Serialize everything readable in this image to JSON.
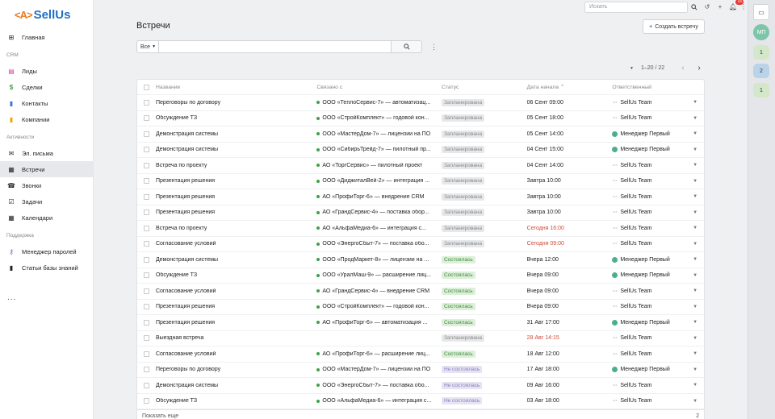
{
  "app": {
    "logo_brackets": "<A>",
    "logo_name": "SellUs"
  },
  "sidebar": {
    "home": "Главная",
    "section_crm": "CRM",
    "leads": "Лиды",
    "deals": "Сделки",
    "contacts": "Контакты",
    "companies": "Компании",
    "section_activities": "Активности",
    "emails": "Эл. письма",
    "meetings": "Встречи",
    "calls": "Звонки",
    "tasks": "Задачи",
    "calendars": "Календари",
    "section_support": "Поддержка",
    "password_manager": "Менеджер паролей",
    "kb_articles": "Статьи базы знаний",
    "more": "..."
  },
  "topbar": {
    "search_placeholder": "Искать",
    "notif_count": "15"
  },
  "page": {
    "title": "Встречи",
    "create_button": "Создать встречу",
    "filter_select": "Все",
    "pager": "1–20 / 22"
  },
  "table": {
    "headers": {
      "name": "Название",
      "related": "Связано с",
      "status": "Статус",
      "date": "Дата начала",
      "owner": "Ответственный"
    },
    "rows": [
      {
        "name": "Переговоры по договору",
        "related": "ООО «ТеплоСервис-7» — автоматизац...",
        "status": "Запланирована",
        "date": "06 Сент 09:00",
        "owner": "SellUs Team"
      },
      {
        "name": "Обсуждение ТЗ",
        "related": "ООО «СтройКомплект» — годовой кон...",
        "status": "Запланирована",
        "date": "05 Сент 18:00",
        "owner": "SellUs Team"
      },
      {
        "name": "Демонстрация системы",
        "related": "ООО «МастерДом-7» — лицензии на ПО",
        "status": "Запланирована",
        "date": "05 Сент 14:00",
        "owner": "Менеджер Первый"
      },
      {
        "name": "Демонстрация системы",
        "related": "ООО «СибирьТрейд-7» — пилотный пр...",
        "status": "Запланирована",
        "date": "04 Сент 15:00",
        "owner": "Менеджер Первый"
      },
      {
        "name": "Встреча по проекту",
        "related": "АО «ТоргСервис» — пилотный проект",
        "status": "Запланирована",
        "date": "04 Сент 14:00",
        "owner": "SellUs Team"
      },
      {
        "name": "Презентация решения",
        "related": "ООО «ДиджиталВей-2» — интеграция ...",
        "status": "Запланирована",
        "date": "Завтра 10:00",
        "owner": "SellUs Team"
      },
      {
        "name": "Презентация решения",
        "related": "АО «ПрофиТорг-6» — внедрение CRM",
        "status": "Запланирована",
        "date": "Завтра 10:00",
        "owner": "SellUs Team"
      },
      {
        "name": "Презентация решения",
        "related": "АО «ГрандСервис-4» — поставка обор...",
        "status": "Запланирована",
        "date": "Завтра 10:00",
        "owner": "SellUs Team"
      },
      {
        "name": "Встреча по проекту",
        "related": "АО «АльфаМедиа-6» — интеграция с...",
        "status": "Запланирована",
        "date": "Сегодня 16:00",
        "owner": "SellUs Team",
        "overdue": true
      },
      {
        "name": "Согласование условий",
        "related": "ООО «ЭнергоСбыт-7» — поставка обо...",
        "status": "Запланирована",
        "date": "Сегодня 09:00",
        "owner": "SellUs Team",
        "overdue": true
      },
      {
        "name": "Демонстрация системы",
        "related": "ООО «ПродМаркет-8» — лицензии на ...",
        "status": "Состоялась",
        "date": "Вчера 12:00",
        "owner": "Менеджер Первый"
      },
      {
        "name": "Обсуждение ТЗ",
        "related": "ООО «УралМаш-9» — расширение лиц...",
        "status": "Состоялась",
        "date": "Вчера 09:00",
        "owner": "Менеджер Первый"
      },
      {
        "name": "Согласование условий",
        "related": "АО «ГрандСервис-4» — внедрение CRM",
        "status": "Состоялась",
        "date": "Вчера 09:00",
        "owner": "SellUs Team"
      },
      {
        "name": "Презентация решения",
        "related": "ООО «СтройКомплект» — годовой кон...",
        "status": "Состоялась",
        "date": "Вчера 09:00",
        "owner": "SellUs Team"
      },
      {
        "name": "Презентация решения",
        "related": "АО «ПрофиТорг-6» — автоматизация ...",
        "status": "Состоялась",
        "date": "31 Авг 17:00",
        "owner": "Менеджер Первый"
      },
      {
        "name": "Выездная встреча",
        "related": "",
        "status": "Запланирована",
        "date": "28 Авг 14:15",
        "owner": "SellUs Team",
        "overdue": true
      },
      {
        "name": "Согласование условий",
        "related": "АО «ПрофиТорг-6» — расширение лиц...",
        "status": "Состоялась",
        "date": "18 Авг 12:00",
        "owner": "SellUs Team"
      },
      {
        "name": "Переговоры по договору",
        "related": "ООО «МастерДом-7» — лицензии на ПО",
        "status": "Не состоялась",
        "date": "17 Авг 18:00",
        "owner": "Менеджер Первый"
      },
      {
        "name": "Демонстрация системы",
        "related": "ООО «ЭнергоСбыт-7» — поставка обо...",
        "status": "Не состоялась",
        "date": "09 Авг 16:00",
        "owner": "SellUs Team"
      },
      {
        "name": "Обсуждение ТЗ",
        "related": "ООО «АльфаМедиа-6» — интеграция с...",
        "status": "Не состоялась",
        "date": "03 Авг 18:00",
        "owner": "SellUs Team"
      }
    ]
  },
  "footer": {
    "show_more": "Показать еще",
    "remaining": "2"
  },
  "rightbar": {
    "avatar": "МП",
    "chip1": "1",
    "chip2": "2",
    "chip3": "1"
  }
}
